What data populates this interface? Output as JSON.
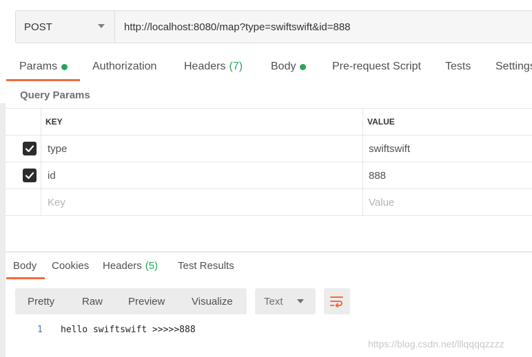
{
  "request": {
    "method": "POST",
    "url": "http://localhost:8080/map?type=swiftswift&id=888"
  },
  "request_tabs": [
    {
      "label": "Params",
      "indicator": "dot"
    },
    {
      "label": "Authorization"
    },
    {
      "label": "Headers",
      "count": "(7)"
    },
    {
      "label": "Body",
      "indicator": "dot"
    },
    {
      "label": "Pre-request Script"
    },
    {
      "label": "Tests"
    },
    {
      "label": "Settings"
    }
  ],
  "query_params": {
    "title": "Query Params",
    "columns": {
      "key": "KEY",
      "value": "VALUE"
    },
    "rows": [
      {
        "checked": true,
        "key": "type",
        "value": "swiftswift"
      },
      {
        "checked": true,
        "key": "id",
        "value": "888"
      }
    ],
    "placeholder": {
      "key": "Key",
      "value": "Value"
    }
  },
  "response_tabs": [
    {
      "label": "Body"
    },
    {
      "label": "Cookies"
    },
    {
      "label": "Headers",
      "count": "(5)"
    },
    {
      "label": "Test Results"
    }
  ],
  "view_modes": [
    "Pretty",
    "Raw",
    "Preview",
    "Visualize"
  ],
  "format": "Text",
  "response_body": {
    "line_number": "1",
    "text": "hello swiftswift >>>>>888"
  },
  "watermark": "https://blog.csdn.net/lllqqqqzzzz",
  "colors": {
    "accent": "#f26b3a",
    "status_green": "#26a65b"
  }
}
